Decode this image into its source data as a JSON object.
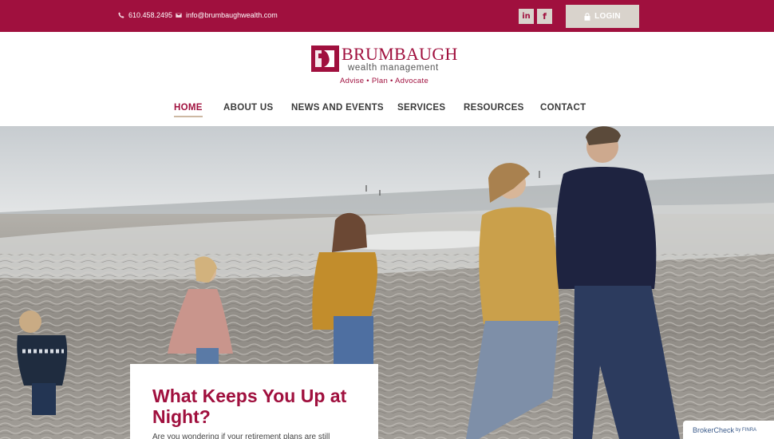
{
  "topbar": {
    "phone": "610.458.2495",
    "email": "info@brumbaughwealth.com",
    "linkedin_label": "in",
    "facebook_label": "f",
    "login_label": "LOGIN",
    "phone_icon": "phone-icon",
    "email_icon": "email-icon",
    "lock_icon": "lock-icon"
  },
  "logo": {
    "brand": "BRUMBAUGH",
    "subtitle": "wealth management",
    "tagline": "Advise • Plan • Advocate"
  },
  "nav": {
    "items": [
      {
        "label": "HOME",
        "active": true
      },
      {
        "label": "ABOUT US",
        "active": false
      },
      {
        "label": "NEWS AND EVENTS",
        "active": false
      },
      {
        "label": "SERVICES",
        "active": false
      },
      {
        "label": "RESOURCES",
        "active": false
      },
      {
        "label": "CONTACT",
        "active": false
      }
    ]
  },
  "hero": {
    "card_heading": "What Keeps You Up at Night?",
    "card_text": "Are you wondering if your retirement plans are still"
  },
  "brokercheck": {
    "label_a": "Broker",
    "label_b": "Check",
    "label_c": "by FINRA"
  },
  "colors": {
    "brand": "#a0103e",
    "button": "#d9d3cc",
    "nav_text": "#3a3a3a"
  }
}
